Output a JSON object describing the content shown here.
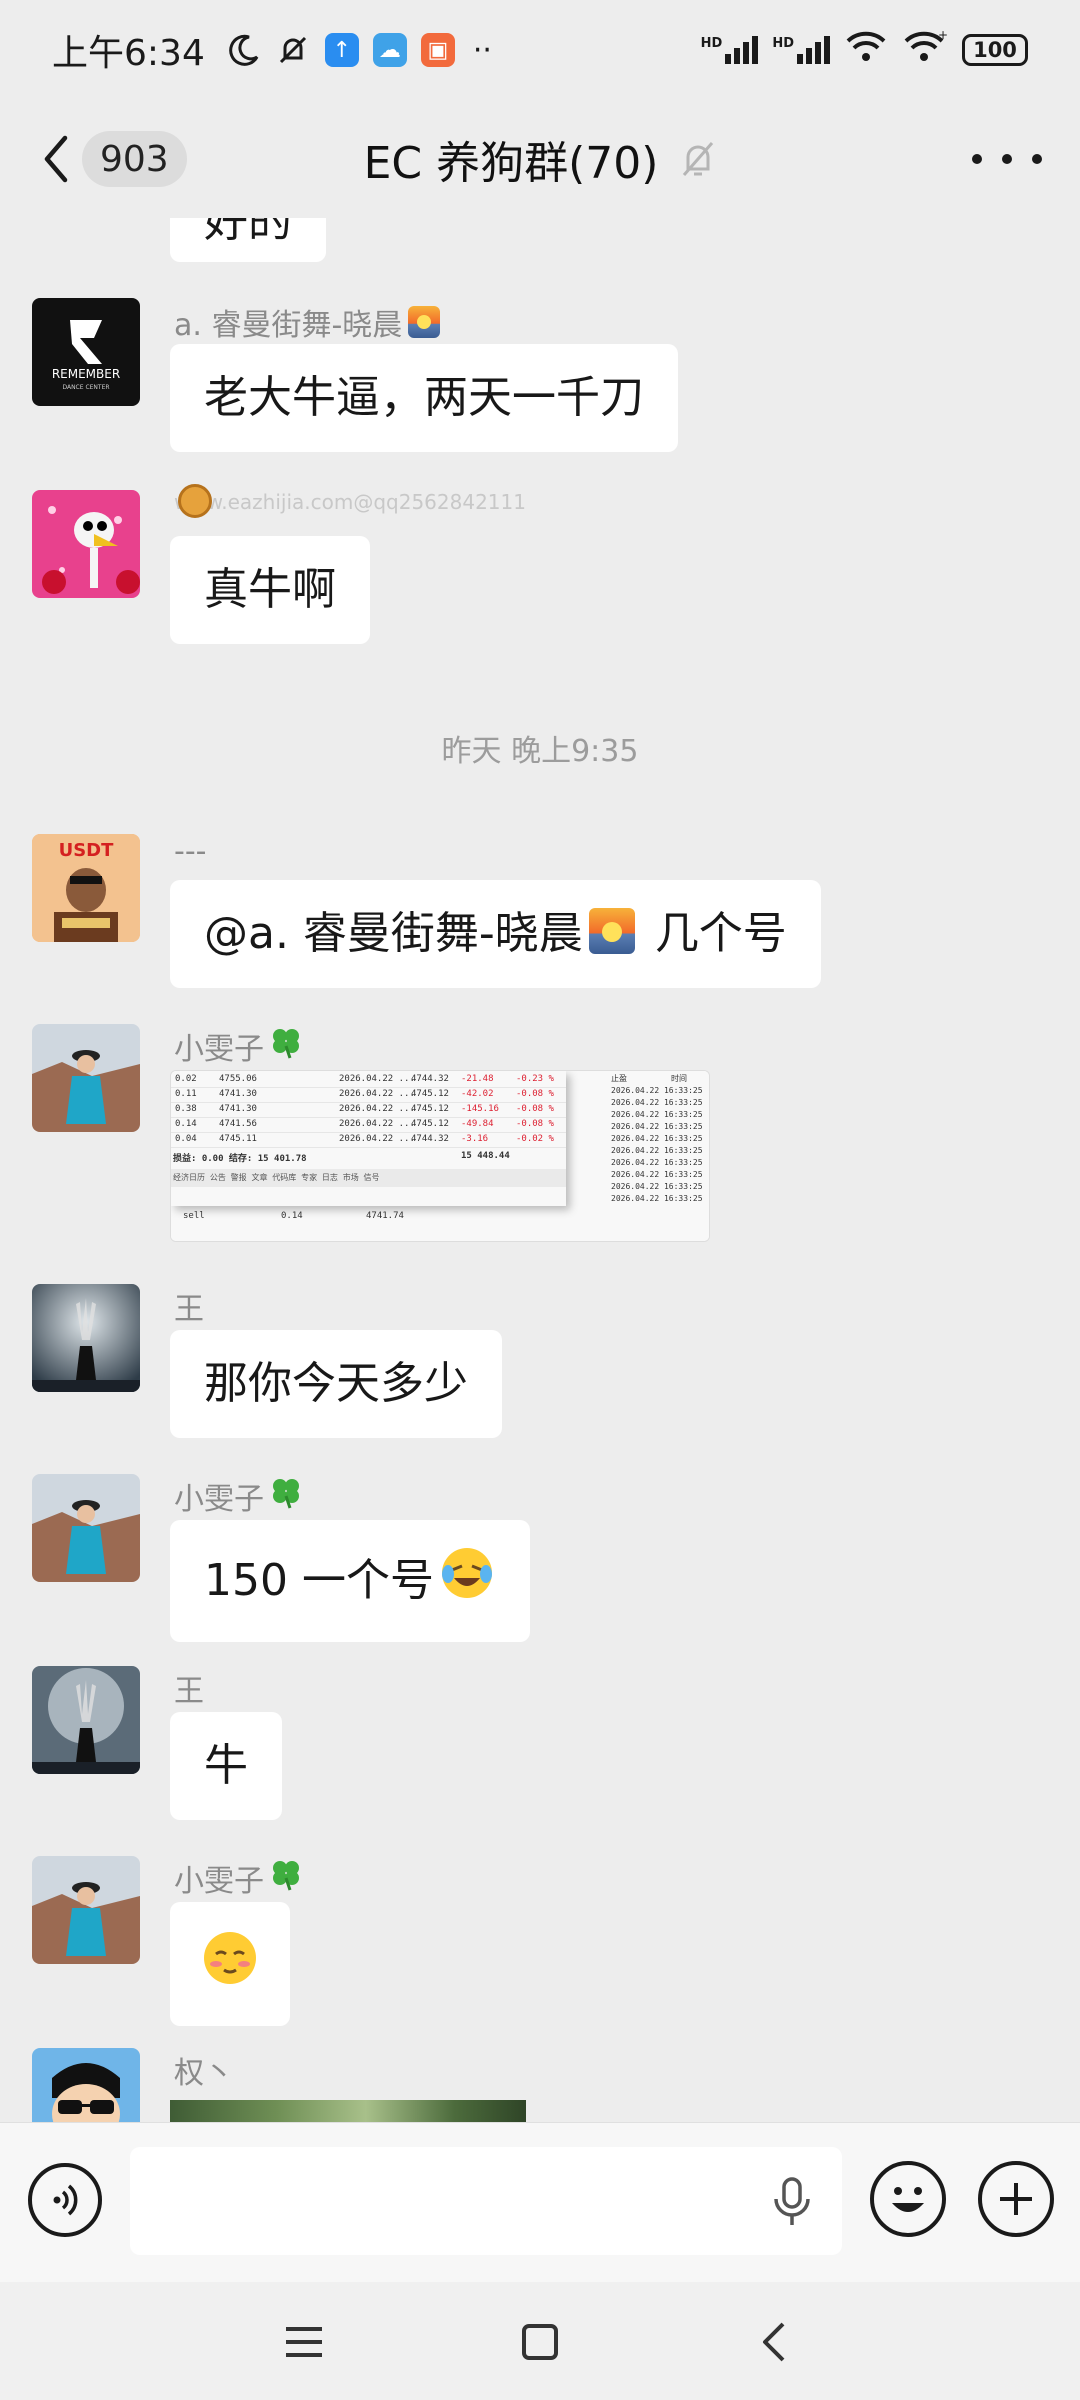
{
  "status_bar": {
    "time": "上午6:34",
    "battery": "100",
    "network_badge_1": "HD",
    "network_badge_2": "HD"
  },
  "header": {
    "unread_count": "903",
    "title": "EC 养狗群(70)"
  },
  "messages": [
    {
      "sender": "",
      "text": "好的"
    },
    {
      "sender": "a. 睿曼街舞-晓晨",
      "text": "老大牛逼，两天一千刀",
      "avatar_text": "REMEMBER",
      "avatar_subtext": "DANCE CENTER"
    },
    {
      "sender": "",
      "watermark": "www.eazhijia.com@qq2562842111",
      "text": "真牛啊"
    },
    {
      "time_divider": "昨天 晚上9:35"
    },
    {
      "sender": "---",
      "text_prefix": "@a. 睿曼街舞-晓晨",
      "text_suffix": "几个号",
      "avatar_text": "USDT"
    },
    {
      "sender": "小雯子",
      "type": "image"
    },
    {
      "sender": "王",
      "text": "那你今天多少"
    },
    {
      "sender": "小雯子",
      "text": "150 一个号"
    },
    {
      "sender": "王",
      "text": "牛"
    },
    {
      "sender": "小雯子",
      "text": ""
    },
    {
      "sender": "权丶",
      "type": "photo"
    }
  ],
  "image_table": {
    "rows": [
      [
        "0.02",
        "4755.06",
        "2026.04.22 ...",
        "4744.32",
        "-21.48",
        "-0.23 %"
      ],
      [
        "0.11",
        "4741.30",
        "2026.04.22 ...",
        "4745.12",
        "-42.02",
        "-0.08 %"
      ],
      [
        "0.38",
        "4741.30",
        "2026.04.22 ...",
        "4745.12",
        "-145.16",
        "-0.08 %"
      ],
      [
        "0.14",
        "4741.56",
        "2026.04.22 ...",
        "4745.12",
        "-49.84",
        "-0.08 %"
      ],
      [
        "0.04",
        "4745.11",
        "2026.04.22 ...",
        "4744.32",
        "-3.16",
        "-0.02 %"
      ]
    ],
    "summary_left": "损益: 0.00  结存: 15 401.78",
    "summary_right": "15 448.44",
    "right_header_1": "止盈",
    "right_header_2": "时间",
    "right_times": [
      "2026.04.22 16:33:25",
      "2026.04.22 16:33:25",
      "2026.04.22 16:33:25",
      "2026.04.22 16:33:25",
      "2026.04.22 16:33:25",
      "2026.04.22 16:33:25",
      "2026.04.22 16:33:25",
      "2026.04.22 16:33:25",
      "2026.04.22 16:33:25",
      "2026.04.22 16:33:25"
    ],
    "toolbar": "经济日历  公告  警报  文章  代码库  专家  日志  市场  信号",
    "bottom_row": [
      "sell",
      "0.14",
      "4741.74"
    ]
  },
  "colors": {
    "background": "#ededed",
    "bubble": "#ffffff",
    "sender_text": "#8a8a8a",
    "divider_text": "#9c9c9c"
  },
  "icons": {
    "back": "chevron-left-icon",
    "mute": "bell-off-icon",
    "more": "more-dots-icon",
    "voice": "voice-icon",
    "mic": "mic-icon",
    "emoji": "emoji-icon",
    "plus": "plus-icon",
    "nav_menu": "menu-icon",
    "nav_home": "home-icon",
    "nav_back": "back-triangle-icon"
  }
}
